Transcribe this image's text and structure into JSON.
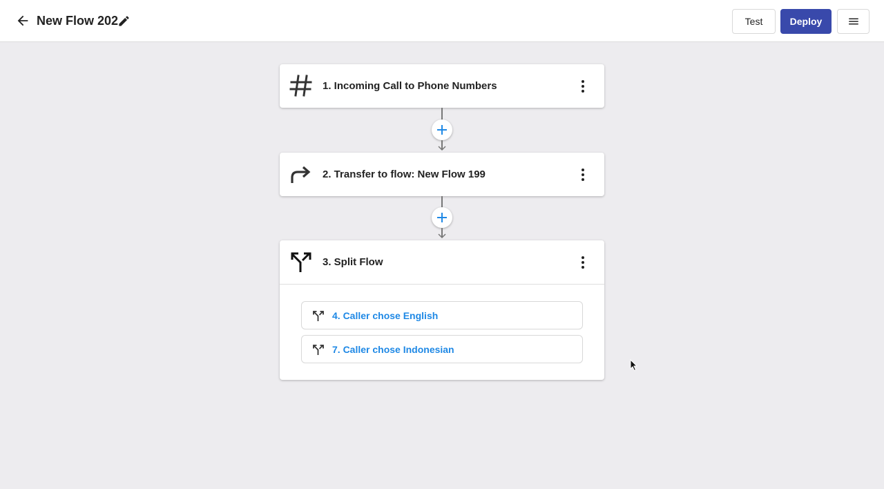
{
  "header": {
    "title": "New Flow 202",
    "back_icon": "arrow-left-icon",
    "edit_icon": "pencil-icon",
    "test_label": "Test",
    "deploy_label": "Deploy",
    "menu_icon": "notes-icon",
    "deploy_color": "#3949ab"
  },
  "steps": [
    {
      "title": "1. Incoming Call to Phone Numbers",
      "icon": "hash-icon"
    },
    {
      "title": "2. Transfer to flow: New Flow 199",
      "icon": "forward-arrow-icon"
    },
    {
      "title": "3. Split Flow",
      "icon": "split-icon",
      "branches": [
        {
          "label": "4. Caller chose English",
          "icon": "split-icon"
        },
        {
          "label": "7. Caller chose Indonesian",
          "icon": "split-icon"
        }
      ]
    }
  ],
  "colors": {
    "accent": "#1e88e5",
    "background": "#edecef"
  }
}
